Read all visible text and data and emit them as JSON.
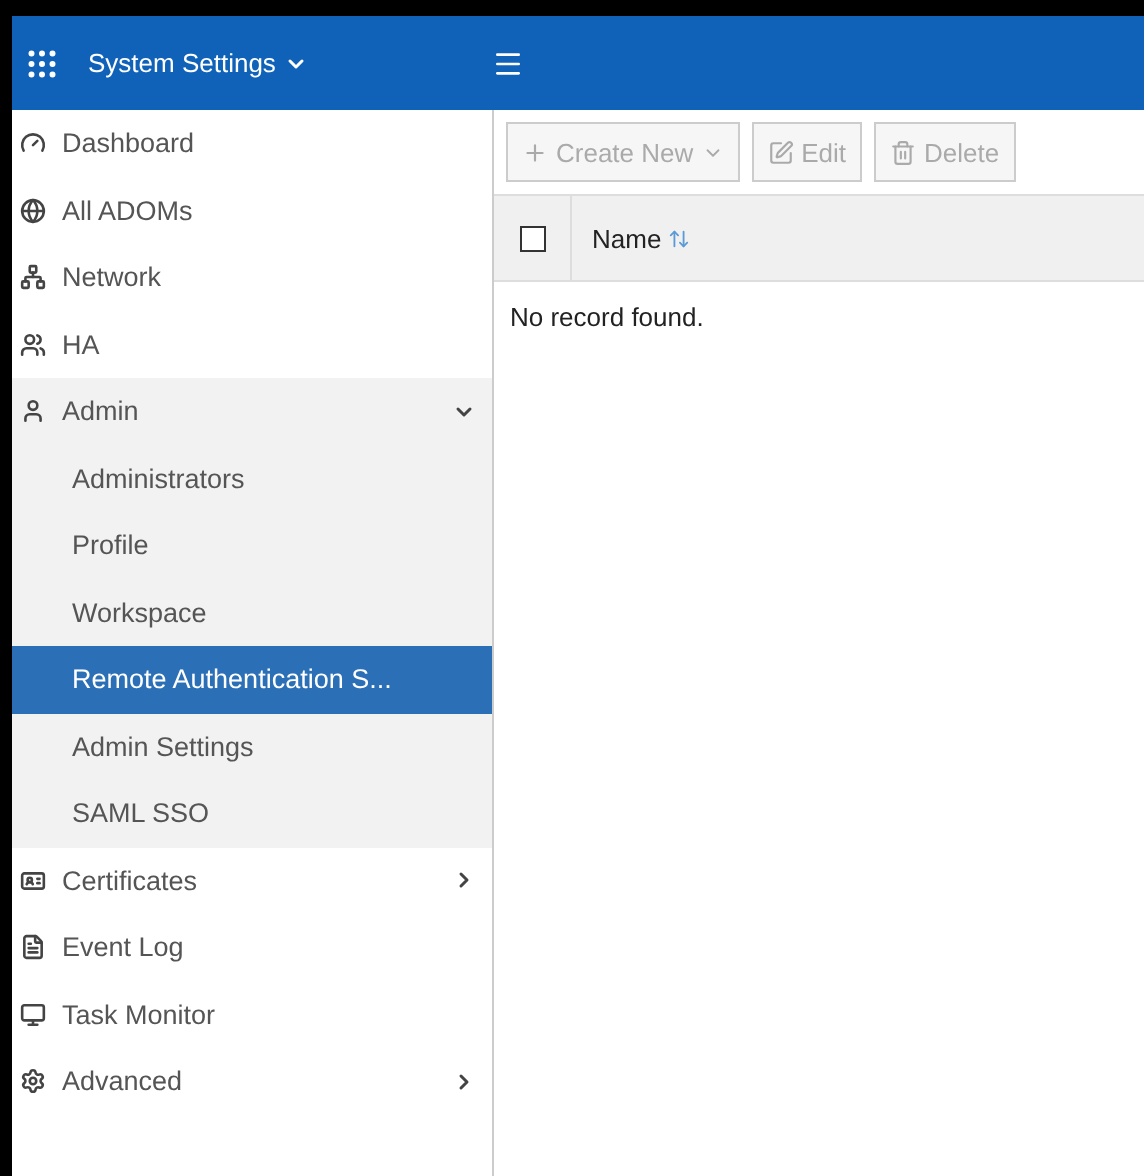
{
  "header": {
    "title": "System Settings"
  },
  "sidebar": {
    "items": [
      {
        "label": "Dashboard",
        "kind": "item",
        "selected": false
      },
      {
        "label": "All ADOMs",
        "kind": "item",
        "selected": false
      },
      {
        "label": "Network",
        "kind": "item",
        "selected": false
      },
      {
        "label": "HA",
        "kind": "item",
        "selected": false
      },
      {
        "label": "Admin",
        "kind": "group",
        "expanded": true,
        "selected": false,
        "children": [
          {
            "label": "Administrators",
            "selected": false
          },
          {
            "label": "Profile",
            "selected": false
          },
          {
            "label": "Workspace",
            "selected": false
          },
          {
            "label": "Remote Authentication S...",
            "selected": true
          },
          {
            "label": "Admin Settings",
            "selected": false
          },
          {
            "label": "SAML SSO",
            "selected": false
          }
        ]
      },
      {
        "label": "Certificates",
        "kind": "group",
        "expanded": false,
        "selected": false
      },
      {
        "label": "Event Log",
        "kind": "item",
        "selected": false
      },
      {
        "label": "Task Monitor",
        "kind": "item",
        "selected": false
      },
      {
        "label": "Advanced",
        "kind": "group",
        "expanded": false,
        "selected": false
      }
    ]
  },
  "toolbar": [
    {
      "label": "Create New",
      "kind": "create",
      "disabled": true
    },
    {
      "label": "Edit",
      "kind": "edit",
      "disabled": true
    },
    {
      "label": "Delete",
      "kind": "delete",
      "disabled": true
    }
  ],
  "table": {
    "select_all_checked": false,
    "columns": [
      "Name"
    ],
    "empty_message": "No record found."
  }
}
